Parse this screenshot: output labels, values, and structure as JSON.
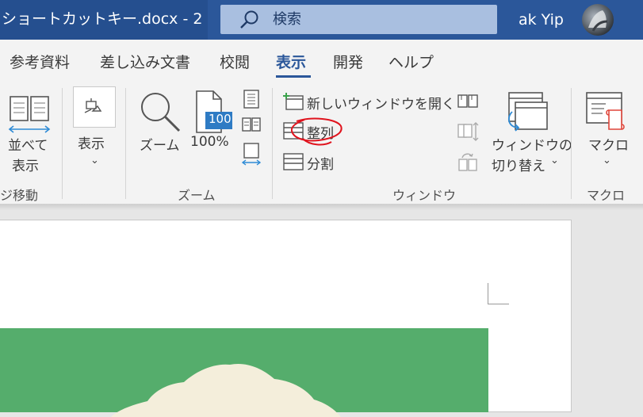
{
  "title_bar": {
    "document_title": "ショートカットキー.docx  -  2",
    "dropdown_icon": "caret-down-icon",
    "search_placeholder": "検索",
    "user_name": "ak Yip"
  },
  "tabs": [
    "参考資料",
    "差し込み文書",
    "校閲",
    "表示",
    "開発",
    "ヘルプ"
  ],
  "active_tab": "表示",
  "ribbon": {
    "side_by_side": {
      "line1": "並べて",
      "line2": "表示"
    },
    "move_group_label": "ジ移動",
    "show": {
      "label": "表示"
    },
    "zoom": {
      "zoom_label": "ズーム",
      "percent_label": "100%",
      "percent_icon_text": "100",
      "group_label": "ズーム"
    },
    "window": {
      "new_window": "新しいウィンドウを開く",
      "arrange": "整列",
      "split": "分割",
      "switch_line1": "ウィンドウの",
      "switch_line2": "切り替え",
      "group_label": "ウィンドウ"
    },
    "macro": {
      "label": "マクロ",
      "group_label": "マクロ"
    }
  },
  "colors": {
    "title_bar": "#2b579a",
    "accent": "#2b579a",
    "annotation": "#e0141e",
    "document_image": "#55ad6c"
  }
}
